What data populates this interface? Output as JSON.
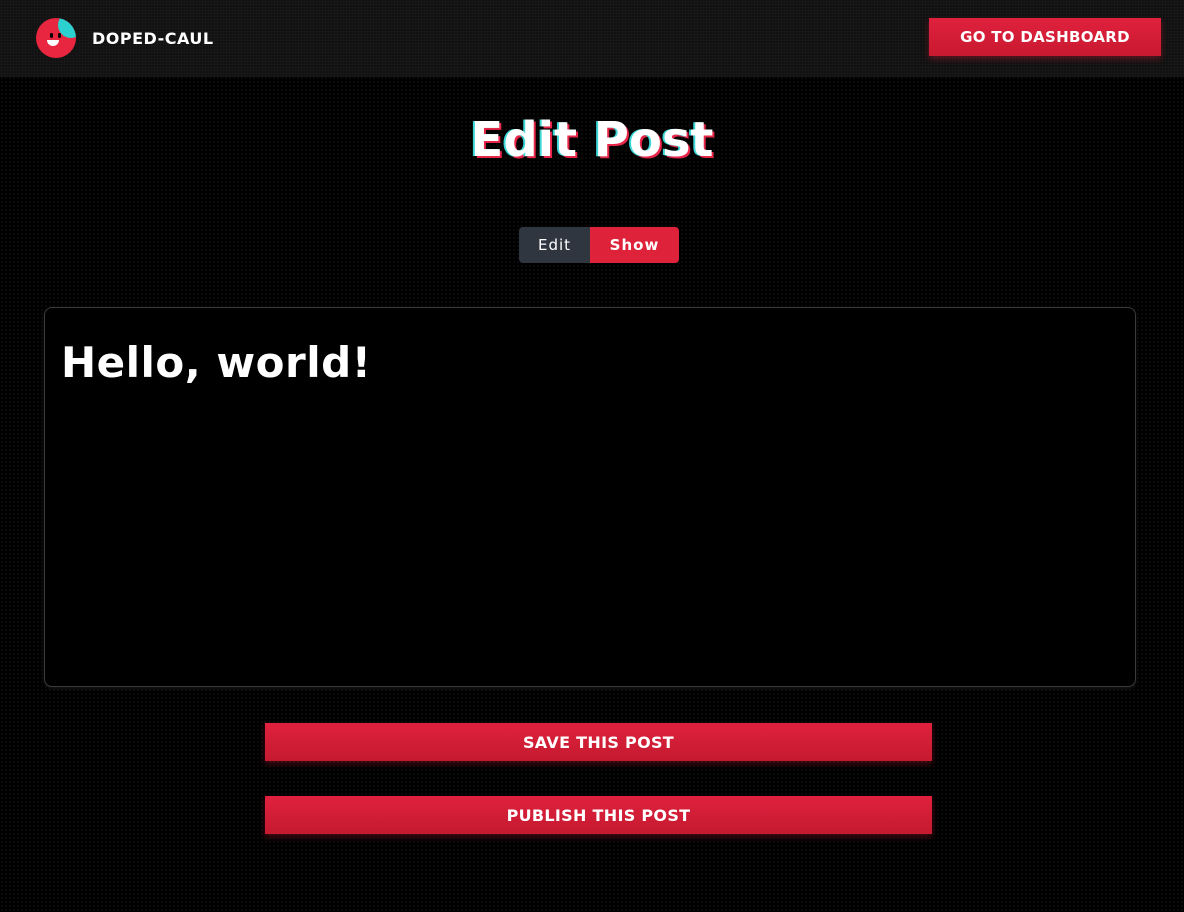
{
  "brand": {
    "name": "DOPED-CAUL",
    "logo_icon": "smiley-logo-icon"
  },
  "header": {
    "dashboard_label": "GO TO DASHBOARD"
  },
  "page": {
    "title": "Edit Post"
  },
  "view_toggle": {
    "edit_label": "Edit",
    "show_label": "Show",
    "selected": "Show"
  },
  "editor": {
    "content": "Hello, world!"
  },
  "actions": {
    "save_label": "SAVE THIS POST",
    "publish_label": "PUBLISH THIS POST"
  },
  "colors": {
    "accent": "#dd2239",
    "teal": "#2ad1cf",
    "toggle_inactive": "#2f3640",
    "background": "#000000"
  }
}
